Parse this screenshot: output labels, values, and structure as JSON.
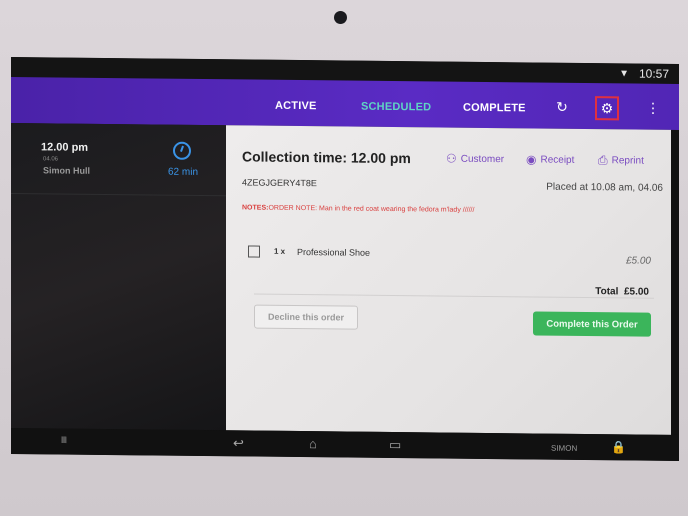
{
  "status_bar": {
    "time": "10:57",
    "wifi_icon": "wifi-icon"
  },
  "app_bar": {
    "tabs": [
      {
        "label": "ACTIVE",
        "selected": false
      },
      {
        "label": "SCHEDULED",
        "selected": true
      },
      {
        "label": "COMPLETE",
        "selected": false
      }
    ],
    "icons": [
      "refresh-icon",
      "gear-icon",
      "more-vert-icon"
    ],
    "accent": "#5a2bc4",
    "selected_tab_color": "#5fd4c4"
  },
  "sidebar": {
    "orders": [
      {
        "time": "12.00 pm",
        "date": "04.06",
        "customer": "Simon Hull",
        "countdown": "62 min"
      }
    ]
  },
  "order": {
    "collection_time": "Collection time: 12.00 pm",
    "actions": {
      "customer": "Customer",
      "receipt": "Receipt",
      "reprint": "Reprint"
    },
    "reference": "4ZEGJGERY4T8E",
    "placed": "Placed at 10.08 am, 04.06",
    "notes_label": "NOTES:",
    "notes_text": "ORDER NOTE: Man in the red coat wearing the fedora m'lady //////",
    "items": [
      {
        "qty": "1 x",
        "name": "Professional Shoe",
        "price": "£5.00",
        "checked": false
      }
    ],
    "total_label": "Total",
    "total_value": "£5.00",
    "decline_label": "Decline this order",
    "complete_label": "Complete this Order",
    "complete_color": "#3bb55b"
  },
  "nav_bar": {
    "user": "SIMON",
    "barcode": "||||||"
  }
}
